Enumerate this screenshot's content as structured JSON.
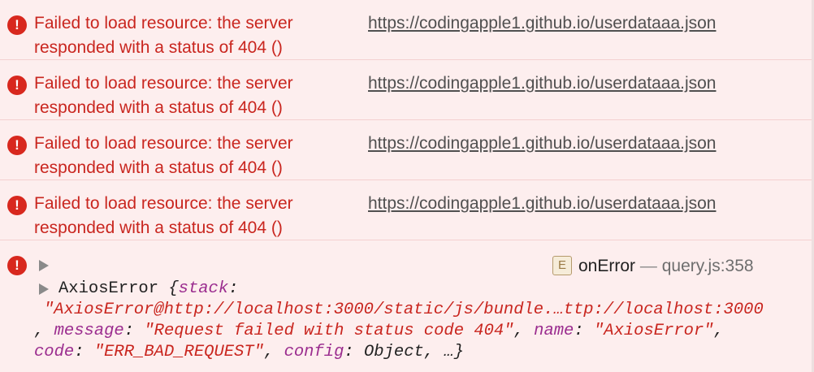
{
  "network_errors": [
    {
      "message": "Failed to load resource: the server responded with a status of 404 ()",
      "url": "https://codingapple1.github.io/userdataaa.json"
    },
    {
      "message": "Failed to load resource: the server responded with a status of 404 ()",
      "url": "https://codingapple1.github.io/userdataaa.json"
    },
    {
      "message": "Failed to load resource: the server responded with a status of 404 ()",
      "url": "https://codingapple1.github.io/userdataaa.json"
    },
    {
      "message": "Failed to load resource: the server responded with a status of 404 ()",
      "url": "https://codingapple1.github.io/userdataaa.json"
    }
  ],
  "message_line1": "Failed to load resource: the server",
  "message_line2": "responded with a status of 404 ()",
  "error_icon_glyph": "!",
  "icons": [
    "error-icon",
    "disclosure-triangle-icon",
    "event-listener-badge-icon"
  ],
  "colors": {
    "background": "#fdeeee",
    "error_red": "#d8281e",
    "key_purple": "#9b2d8f"
  },
  "axios_entry": {
    "badge_letter": "E",
    "function_name": "onError",
    "separator": "—",
    "source_location": "query.js:358",
    "object_name": "AxiosError",
    "open_brace": "{",
    "stack_key": "stack",
    "stack_value": "\"AxiosError@http://localhost:3000/static/js/bundle.…ttp://localhost:3000",
    "message_key": "message",
    "message_value": "\"Request failed with status code 404\"",
    "name_key": "name",
    "name_value": "\"AxiosError\"",
    "code_key": "code",
    "code_value": "\"ERR_BAD_REQUEST\"",
    "config_key": "config",
    "config_value": "Object",
    "ellipsis_close": "…}"
  }
}
